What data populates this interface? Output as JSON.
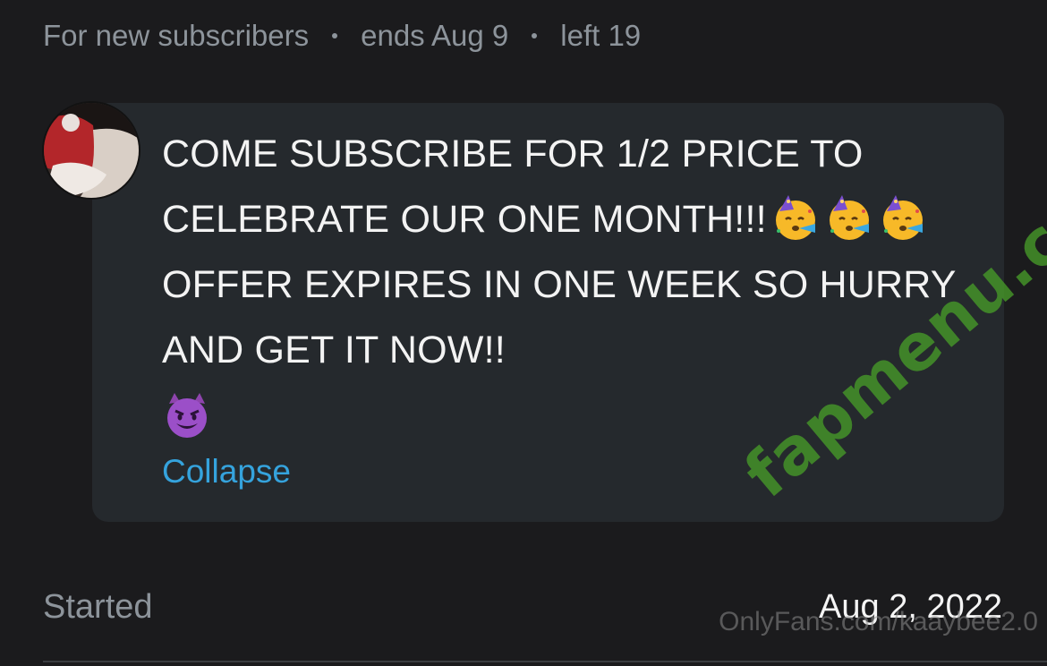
{
  "promo": {
    "audience": "For new subscribers",
    "ends": "ends Aug 9",
    "left": "left 19"
  },
  "message": {
    "line1": "COME SUBSCRIBE FOR 1/2 PRICE TO",
    "line2": "CELEBRATE OUR ONE MONTH!!!",
    "line3": "OFFER EXPIRES IN ONE WEEK SO HURRY",
    "line4": "AND GET IT NOW!!",
    "emojis_line2": [
      "partying-face-emoji",
      "partying-face-emoji",
      "partying-face-emoji"
    ],
    "emoji_line5": "smiling-devil-emoji"
  },
  "collapse_label": "Collapse",
  "started": {
    "label": "Started",
    "value": "Aug 2, 2022"
  },
  "watermarks": {
    "site": "fapmenu.com",
    "source": "OnlyFans.com/kaaybee2.0"
  },
  "colors": {
    "background": "#1b1b1d",
    "bubble": "#25292d",
    "link": "#35a3dd",
    "muted_text": "#8d949b"
  }
}
